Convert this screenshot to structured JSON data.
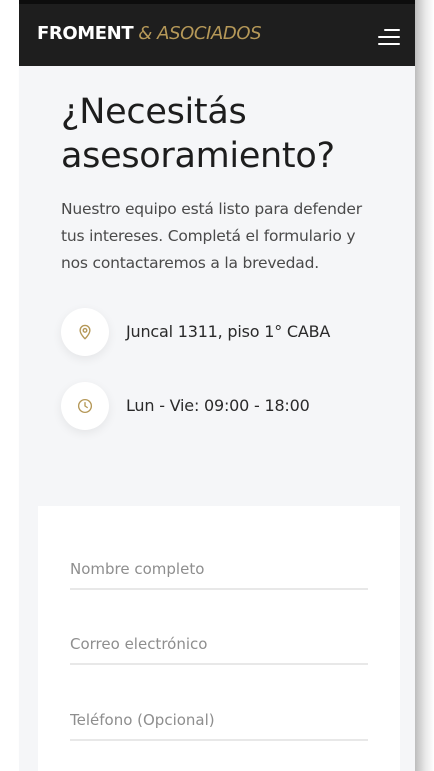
{
  "header": {
    "logo_main": "FROMENT",
    "logo_accent": "& ASOCIADOS",
    "menu_icon": "hamburger-menu-icon"
  },
  "contact": {
    "title": "¿Necesitás asesoramiento?",
    "intro": "Nuestro equipo está listo para defender tus intereses. Completá el formulario y nos contactaremos a la brevedad.",
    "address": {
      "icon": "location-pin-icon",
      "text": "Juncal 1311, piso 1° CABA"
    },
    "hours": {
      "icon": "clock-icon",
      "text": "Lun - Vie: 09:00 - 18:00"
    }
  },
  "form": {
    "name_placeholder": "Nombre completo",
    "email_placeholder": "Correo electrónico",
    "phone_placeholder": "Teléfono (Opcional)"
  },
  "colors": {
    "header_bg": "#1e1e1e",
    "accent_gold": "#b59858",
    "page_bg": "#f5f6f8",
    "text_dark": "#1d1d1d"
  }
}
